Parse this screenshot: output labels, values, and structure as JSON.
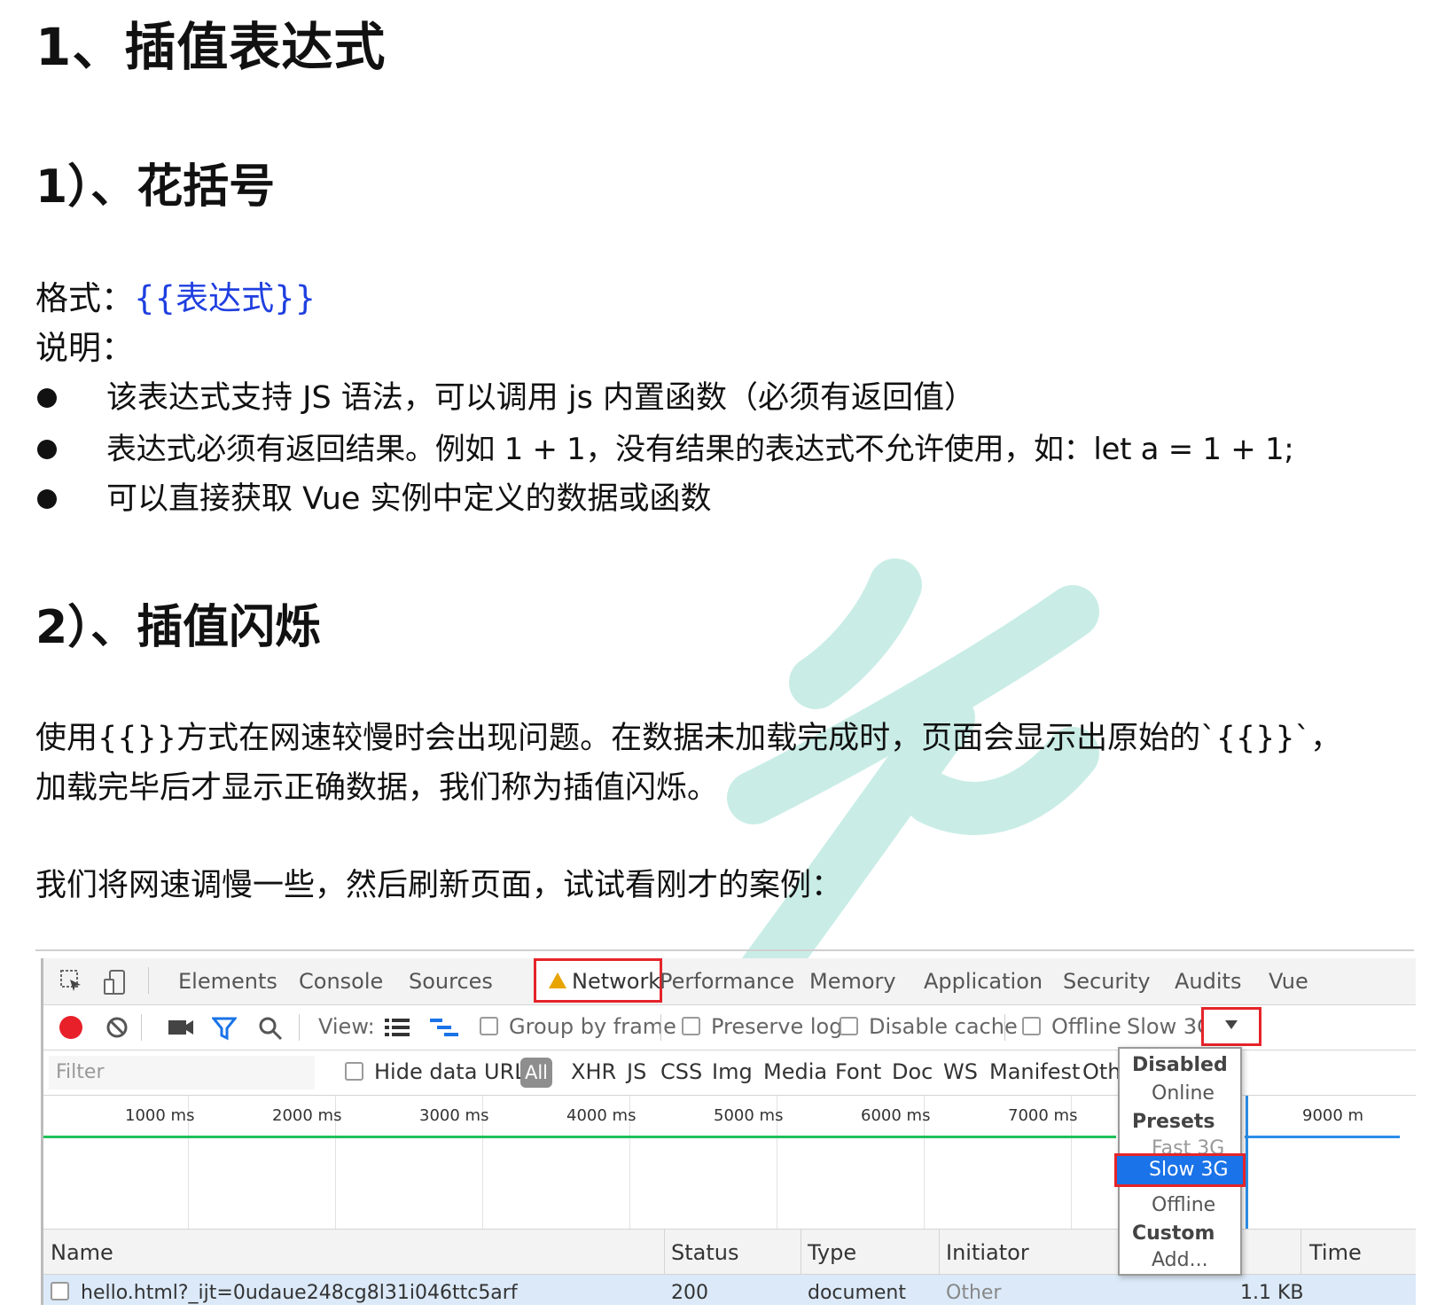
{
  "headings": {
    "h1": "1、插值表达式",
    "h2_a": "1）、花括号",
    "h2_b": "2）、插值闪烁"
  },
  "section1": {
    "format_label": "格式：",
    "format_code": "{{表达式}}",
    "explain_label": "说明：",
    "bullets": [
      "该表达式支持 JS 语法，可以调用 js 内置函数（必须有返回值）",
      "表达式必须有返回结果。例如  1 + 1，没有结果的表达式不允许使用，如：let a = 1 + 1;",
      "可以直接获取 Vue 实例中定义的数据或函数"
    ]
  },
  "section2": {
    "para_line1": "使用{{}}方式在网速较慢时会出现问题。在数据未加载完成时，页面会显示出原始的`{{}}`，",
    "para_line2": "加载完毕后才显示正确数据，我们称为插值闪烁。",
    "para2": "我们将网速调慢一些，然后刷新页面，试试看刚才的案例："
  },
  "devtools": {
    "tabs": [
      "Elements",
      "Console",
      "Sources",
      "Network",
      "Performance",
      "Memory",
      "Application",
      "Security",
      "Audits",
      "Vue"
    ],
    "toolbar": {
      "view_label": "View:",
      "group_by_frame": "Group by frame",
      "preserve_log": "Preserve log",
      "disable_cache": "Disable cache",
      "offline": "Offline",
      "throttle_value": "Slow 3G"
    },
    "filter": {
      "placeholder": "Filter",
      "hide_data_urls": "Hide data URLs",
      "types": [
        "All",
        "XHR",
        "JS",
        "CSS",
        "Img",
        "Media",
        "Font",
        "Doc",
        "WS",
        "Manifest",
        "Oth"
      ]
    },
    "timeline_ticks": [
      "1000 ms",
      "2000 ms",
      "3000 ms",
      "4000 ms",
      "5000 ms",
      "6000 ms",
      "7000 ms",
      "9000 m"
    ],
    "columns": [
      "Name",
      "Status",
      "Type",
      "Initiator",
      "Time"
    ],
    "row": {
      "name": "hello.html?_ijt=0udaue248cg8l31i046ttc5arf",
      "status": "200",
      "type": "document",
      "initiator": "Other",
      "size": "1.1 KB"
    },
    "dropdown": {
      "disabled_header": "Disabled",
      "online": "Online",
      "presets_header": "Presets",
      "fast3g": "Fast 3G",
      "slow3g": "Slow 3G",
      "offline": "Offline",
      "custom_header": "Custom",
      "add": "Add..."
    }
  },
  "colors": {
    "link_blue": "#1f3fe0",
    "highlight_red": "#e5242a",
    "selected_blue": "#1a73e8",
    "watermark": "#9ee0d2"
  }
}
